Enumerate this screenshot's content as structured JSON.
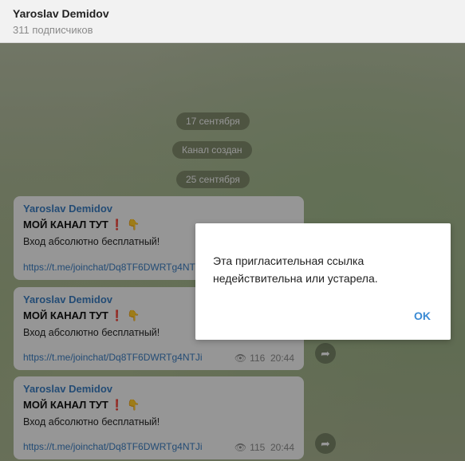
{
  "header": {
    "title": "Yaroslav Demidov",
    "subtitle": "311 подписчиков"
  },
  "dates": [
    "17 сентября",
    "Канал создан",
    "25 сентября"
  ],
  "messages": [
    {
      "author": "Yaroslav Demidov",
      "headline": "МОЙ КАНАЛ ТУТ",
      "excl": "❗",
      "hand": "👇",
      "body": "Вход абсолютно бесплатный!",
      "link": "https://t.me/joinchat/Dq8TF6DWRTg4NTJi",
      "views": "",
      "time": ""
    },
    {
      "author": "Yaroslav Demidov",
      "headline": "МОЙ КАНАЛ ТУТ",
      "excl": "❗",
      "hand": "👇",
      "body": "Вход абсолютно бесплатный!",
      "link": "https://t.me/joinchat/Dq8TF6DWRTg4NTJi",
      "views": "116",
      "time": "20:44"
    },
    {
      "author": "Yaroslav Demidov",
      "headline": "МОЙ КАНАЛ ТУТ",
      "excl": "❗",
      "hand": "👇",
      "body": "Вход абсолютно бесплатный!",
      "link": "https://t.me/joinchat/Dq8TF6DWRTg4NTJi",
      "views": "115",
      "time": "20:44"
    }
  ],
  "icons": {
    "eye": "👁",
    "share": "➦"
  },
  "dialog": {
    "text": "Эта пригласительная ссылка недействительна или устарела.",
    "ok_label": "OK"
  }
}
